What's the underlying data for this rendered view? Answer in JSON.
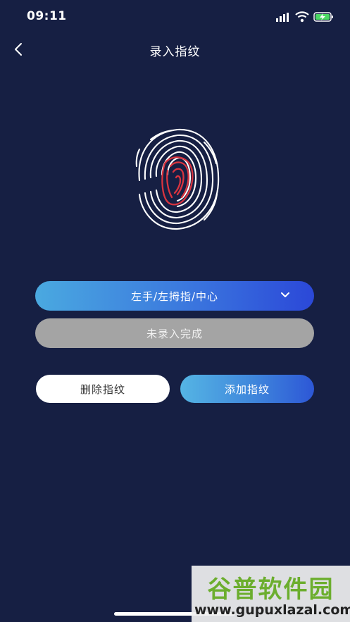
{
  "status_bar": {
    "time": "09:11"
  },
  "nav": {
    "title": "录入指纹",
    "back_icon": "chevron-left-icon"
  },
  "fingerprint": {
    "icon": "fingerprint-icon",
    "ridge_color": "#ffffff",
    "highlight_color": "#d9343f"
  },
  "finger_select": {
    "value": "左手/左拇指/中心",
    "icon": "chevron-down-icon"
  },
  "enroll_status": {
    "text": "未录入完成"
  },
  "actions": {
    "delete_label": "删除指纹",
    "add_label": "添加指纹"
  },
  "colors": {
    "background": "#161f43",
    "accent_start": "#4aa9e0",
    "accent_end": "#2b48d8",
    "status_gray": "#a4a4a4"
  },
  "watermark": {
    "title": "谷普软件园",
    "url": "www.gupuxlazal.com"
  }
}
